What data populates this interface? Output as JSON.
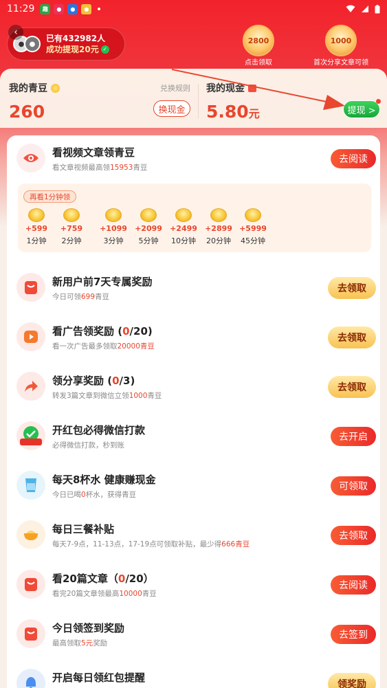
{
  "status_bar": {
    "time": "11:29",
    "apps": [
      "app-1",
      "app-2",
      "app-3",
      "app-4"
    ]
  },
  "header": {
    "ticker_line1": "已有432982人",
    "ticker_line2": "成功提现20元",
    "badges": [
      {
        "value": "2800",
        "label": "点击领取"
      },
      {
        "value": "1000",
        "label": "首次分享文章可领"
      }
    ]
  },
  "wallet": {
    "beans_label": "我的青豆",
    "beans_value": "260",
    "rules_link": "兑换规则",
    "exchange_button": "换现金",
    "cash_label": "我的现金",
    "cash_value": "5.80",
    "cash_unit": "元",
    "withdraw_button": "提现 >"
  },
  "video_task": {
    "title": "看视频文章领青豆",
    "sub_prefix": "看文章视频最高领",
    "sub_highlight": "15953",
    "sub_suffix": "青豆",
    "button": "去阅读",
    "tag": "再看1分钟领",
    "rewards": [
      {
        "reward": "+599",
        "label": "1分钟"
      },
      {
        "reward": "+759",
        "label": "2分钟"
      },
      {
        "reward": "+1099",
        "label": "3分钟"
      },
      {
        "reward": "+2099",
        "label": "5分钟"
      },
      {
        "reward": "+2499",
        "label": "10分钟"
      },
      {
        "reward": "+2899",
        "label": "20分钟"
      },
      {
        "reward": "+5999",
        "label": "45分钟"
      }
    ]
  },
  "tasks": [
    {
      "title": "新用户前7天专属奖励",
      "title_hl": "",
      "title_end": "",
      "sub_a": "今日可领",
      "sub_hl": "699",
      "sub_b": "青豆",
      "button": "去领取",
      "style": "gold"
    },
    {
      "title": "看广告领奖励 (",
      "title_hl": "0",
      "title_end": "/20)",
      "sub_a": "看一次广告最多领取",
      "sub_hl": "20000青豆",
      "sub_b": "",
      "button": "去领取",
      "style": "gold"
    },
    {
      "title": "领分享奖励 (",
      "title_hl": "0",
      "title_end": "/3)",
      "sub_a": "转发3篇文章到微信立领",
      "sub_hl": "1000",
      "sub_b": "青豆",
      "button": "去领取",
      "style": "gold"
    },
    {
      "title": "开红包必得微信打款",
      "title_hl": "",
      "title_end": "",
      "sub_a": "必得微信打款，秒到账",
      "sub_hl": "",
      "sub_b": "",
      "button": "去开启",
      "style": "red",
      "icon_text": "秒提现"
    },
    {
      "title": "每天8杯水 健康赚现金",
      "title_hl": "",
      "title_end": "",
      "sub_a": "今日已喝",
      "sub_hl": "0",
      "sub_b": "杯水，获得青豆",
      "button": "可领取",
      "style": "red"
    },
    {
      "title": "每日三餐补贴",
      "title_hl": "",
      "title_end": "",
      "sub_a": "每天7-9点，11-13点，17-19点可领取补贴，最少得",
      "sub_hl": "666青豆",
      "sub_b": "",
      "button": "去领取",
      "style": "red"
    },
    {
      "title": "看20篇文章（",
      "title_hl": "0",
      "title_end": "/20）",
      "sub_a": "看完20篇文章领最高",
      "sub_hl": "10000",
      "sub_b": "青豆",
      "button": "去阅读",
      "style": "red"
    },
    {
      "title": "今日领签到奖励",
      "title_hl": "",
      "title_end": "",
      "sub_a": "最高领取",
      "sub_hl": "5元",
      "sub_b": "奖励",
      "button": "去签到",
      "style": "red"
    },
    {
      "title": "开启每日领红包提醒",
      "title_hl": "",
      "title_end": "",
      "sub_a": "",
      "sub_hl": "",
      "sub_b": "",
      "button": "领奖励",
      "style": "gold"
    }
  ],
  "colors": {
    "accent": "#e8462e",
    "header_red": "#f2222b",
    "green": "#18a53a",
    "gold": "#f8c251"
  }
}
